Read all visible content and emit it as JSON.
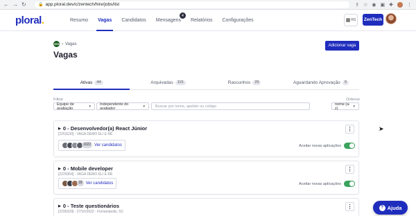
{
  "browser": {
    "url": "app.ploral.dev/c/zentech/hire/jobs/list",
    "nav_icons": [
      "back-arrow",
      "forward-arrow",
      "reload"
    ],
    "tool_icons": [
      "share",
      "star",
      "camera",
      "extension",
      "puzzle"
    ]
  },
  "header": {
    "logo_text": "ploral",
    "logo_dot": ".",
    "nav": [
      {
        "label": "Resumo"
      },
      {
        "label": "Vagas"
      },
      {
        "label": "Candidatos"
      },
      {
        "label": "Mensagens",
        "badge": "4"
      },
      {
        "label": "Relatórios"
      },
      {
        "label": "Configurações"
      }
    ],
    "grid_label": "RS",
    "company": "ZenTech"
  },
  "breadcrumb": {
    "icon_text": "ZEN",
    "label": "Vagas"
  },
  "page_title": "Vagas",
  "add_button": "Adicionar vaga",
  "tabs": [
    {
      "label": "Ativas",
      "count": "44"
    },
    {
      "label": "Arquivadas",
      "count": "115"
    },
    {
      "label": "Rascunhos",
      "count": "29"
    },
    {
      "label": "Aguardando Aprovação",
      "count": "9"
    }
  ],
  "filters": {
    "filter_label": "Filtrar",
    "evaluation_team": "Equipe de avaliação",
    "independent": "Independente do avaliador",
    "search_placeholder": "Buscar por nome, apelido ou código",
    "order_label": "Ordenar",
    "order_value": "nome (a-z)"
  },
  "jobs": [
    {
      "title": "0 - Desenvolvedor(a) React Júnior",
      "sub": "[2253130] - VAGA DEMO ELI E RÊ",
      "count": "1022",
      "link": "Ver candidatos",
      "accept": "Aceitar novas aplicações"
    },
    {
      "title": "0 - Mobile developer",
      "sub": "[2229364] - VAGA DEMO ELI E RÊ",
      "count": "18",
      "link": "Ver candidatos",
      "accept": "Aceitar novas aplicações"
    },
    {
      "title": "0 - Teste questionários",
      "sub": "[2295329] - 27/10/2022 - Florianópolis, SC"
    }
  ],
  "help_button": "Ajuda",
  "colors": {
    "primary": "#1f2dbd",
    "toggle_on": "#3aa35c",
    "logo_dot": "#f2b705"
  }
}
